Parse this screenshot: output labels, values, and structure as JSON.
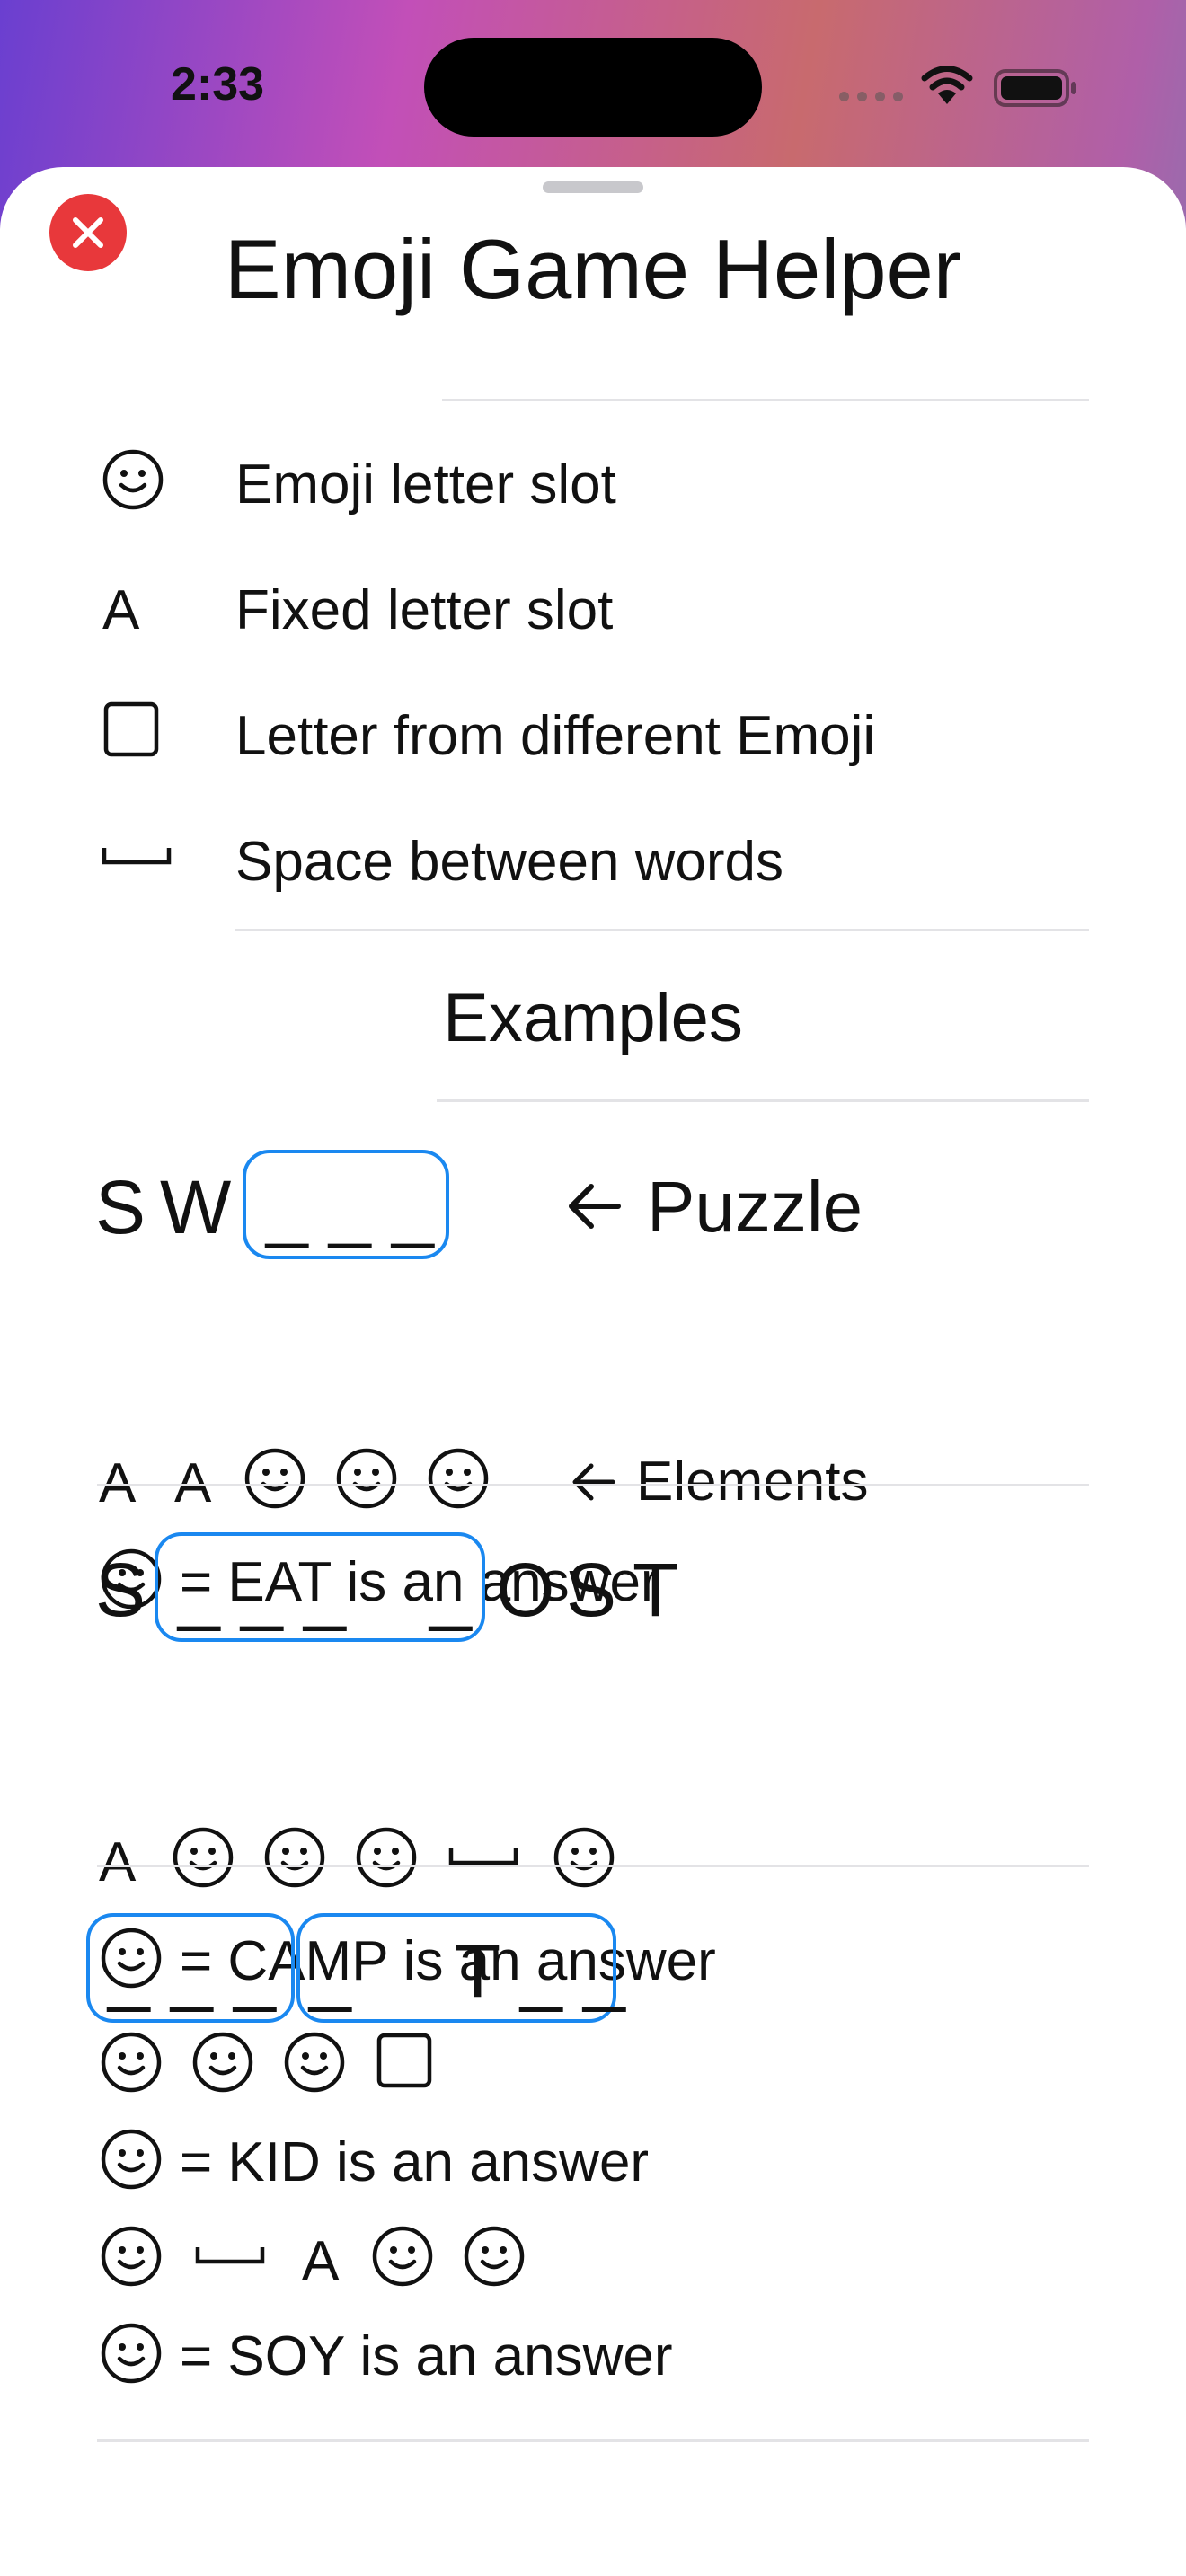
{
  "status_bar": {
    "time": "2:33"
  },
  "sheet": {
    "title": "Emoji Game Helper",
    "legend": [
      {
        "icon": "smiley-icon",
        "label": "Emoji letter slot"
      },
      {
        "icon": "letter-a-icon",
        "glyph": "A",
        "label": "Fixed letter slot"
      },
      {
        "icon": "square-icon",
        "label": "Letter from different Emoji"
      },
      {
        "icon": "space-icon",
        "label": "Space between words"
      }
    ],
    "examples_title": "Examples",
    "example1": {
      "letters": [
        "S",
        "W"
      ],
      "blank": "_ _ _",
      "puzzle_label": "Puzzle",
      "element_glyph": "A",
      "elements_label": "Elements",
      "answer": "= EAT is an answer"
    },
    "example2": {
      "letter_before": "S",
      "blank": "_ _ _    _",
      "letters_after": [
        "O",
        "S",
        "T"
      ],
      "element_glyph": "A",
      "answer": "= CAMP is an answer"
    },
    "example3": {
      "blank1": "_ _ _",
      "blank2": "_     T _ _",
      "answer1": "= KID is an answer",
      "element_glyph": "A",
      "answer2": "= SOY is an answer"
    }
  },
  "colors": {
    "accent": "#1a88f0",
    "close": "#e8383b"
  }
}
